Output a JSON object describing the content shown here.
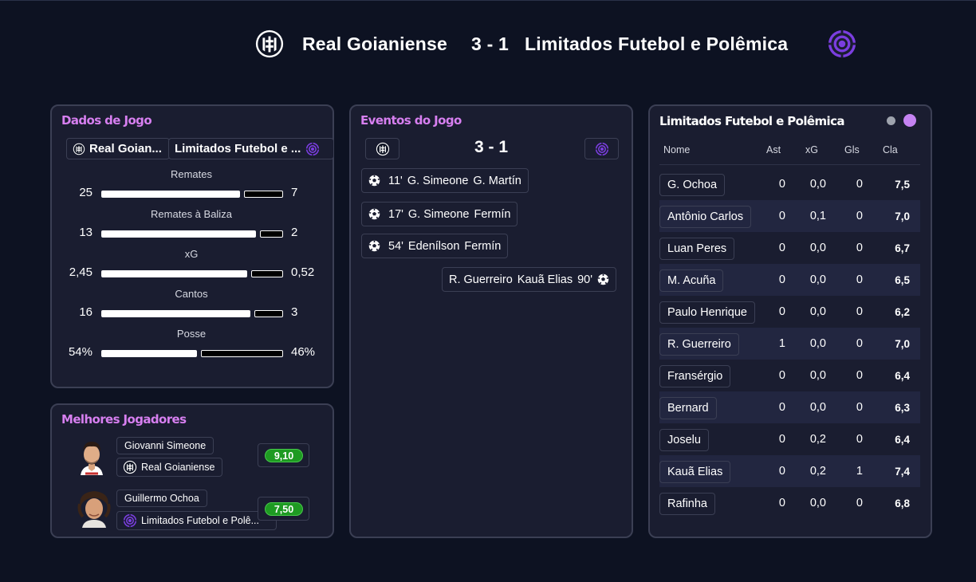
{
  "header": {
    "home_team": "Real Goianiense",
    "score": "3 - 1",
    "away_team": "Limitados Futebol e Polêmica",
    "home_crest_icon": "crest-shield-icon",
    "away_crest_icon": "target-rings-icon"
  },
  "match_stats": {
    "title": "Dados de Jogo",
    "home_tab": "Real Goian...",
    "away_tab": "Limitados Futebol e ...",
    "stats": [
      {
        "label": "Remates",
        "home": "25",
        "away": "7",
        "home_share": 0.78
      },
      {
        "label": "Remates à Baliza",
        "home": "13",
        "away": "2",
        "home_share": 0.87
      },
      {
        "label": "xG",
        "home": "2,45",
        "away": "0,52",
        "home_share": 0.82
      },
      {
        "label": "Cantos",
        "home": "16",
        "away": "3",
        "home_share": 0.84
      },
      {
        "label": "Posse",
        "home": "54%",
        "away": "46%",
        "home_share": 0.54
      }
    ]
  },
  "best_players": {
    "title": "Melhores Jogadores",
    "players": [
      {
        "name": "Giovanni Simeone",
        "team": "Real Goianiense",
        "rating": "9,10"
      },
      {
        "name": "Guillermo Ochoa",
        "team": "Limitados Futebol e Polê...",
        "rating": "7,50"
      }
    ]
  },
  "events": {
    "title": "Eventos do Jogo",
    "score": "3 - 1",
    "home": [
      {
        "minute": "11'",
        "scorer": "G. Simeone",
        "assist": "G. Martín"
      },
      {
        "minute": "17'",
        "scorer": "G. Simeone",
        "assist": "Fermín"
      },
      {
        "minute": "54'",
        "scorer": "Edenílson",
        "assist": "Fermín"
      }
    ],
    "away": [
      {
        "minute": "90'",
        "scorer": "Kauã Elias",
        "assist": "R. Guerreiro"
      }
    ]
  },
  "lineup": {
    "title": "Limitados Futebol e Polêmica",
    "columns": [
      "Nome",
      "Ast",
      "xG",
      "Gls",
      "Cla"
    ],
    "colors": {
      "dot_inactive": "#9ea3ad",
      "dot_active": "#c583f2"
    },
    "rows": [
      {
        "name": "G. Ochoa",
        "ast": "0",
        "xg": "0,0",
        "gls": "0",
        "cla": "7,5"
      },
      {
        "name": "Antônio Carlos",
        "ast": "0",
        "xg": "0,1",
        "gls": "0",
        "cla": "7,0"
      },
      {
        "name": "Luan Peres",
        "ast": "0",
        "xg": "0,0",
        "gls": "0",
        "cla": "6,7"
      },
      {
        "name": "M. Acuña",
        "ast": "0",
        "xg": "0,0",
        "gls": "0",
        "cla": "6,5"
      },
      {
        "name": "Paulo Henrique",
        "ast": "0",
        "xg": "0,0",
        "gls": "0",
        "cla": "6,2"
      },
      {
        "name": "R. Guerreiro",
        "ast": "1",
        "xg": "0,0",
        "gls": "0",
        "cla": "7,0"
      },
      {
        "name": "Fransérgio",
        "ast": "0",
        "xg": "0,0",
        "gls": "0",
        "cla": "6,4"
      },
      {
        "name": "Bernard",
        "ast": "0",
        "xg": "0,0",
        "gls": "0",
        "cla": "6,3"
      },
      {
        "name": "Joselu",
        "ast": "0",
        "xg": "0,2",
        "gls": "0",
        "cla": "6,4"
      },
      {
        "name": "Kauã Elias",
        "ast": "0",
        "xg": "0,2",
        "gls": "1",
        "cla": "7,4"
      },
      {
        "name": "Rafinha",
        "ast": "0",
        "xg": "0,0",
        "gls": "0",
        "cla": "6,8"
      }
    ]
  }
}
